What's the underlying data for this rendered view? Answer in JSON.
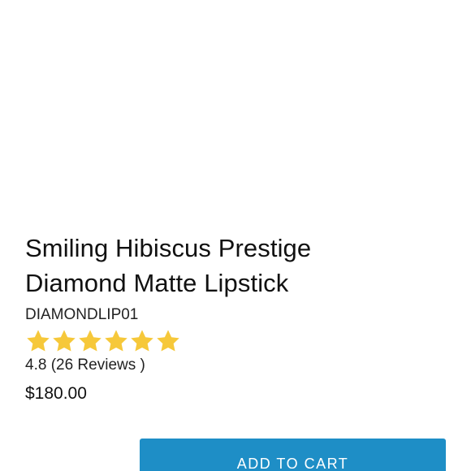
{
  "product": {
    "title_line1": "Smiling Hibiscus Prestige",
    "title_line2": "Diamond Matte Lipstick",
    "sku": "DIAMONDLIP01",
    "rating": {
      "stars_filled": 6,
      "star_color": "#f6c83a",
      "text": "4.8 (26 Reviews )"
    },
    "price": "$180.00"
  },
  "actions": {
    "add_to_cart_label": "ADD TO CART",
    "button_color": "#1e8ec6"
  }
}
